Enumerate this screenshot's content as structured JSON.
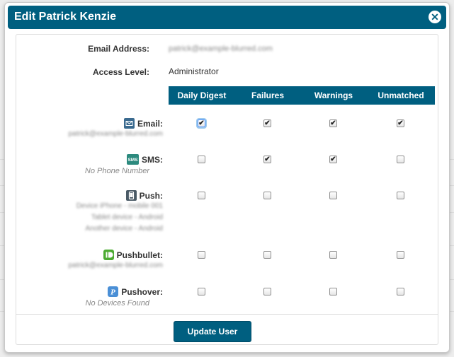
{
  "dialog": {
    "title": "Edit Patrick Kenzie",
    "close_glyph": "✕"
  },
  "account": {
    "email_label": "Email Address:",
    "email_value": "patrick@example-blurred.com",
    "access_label": "Access Level:",
    "access_value": "Administrator"
  },
  "columns": [
    "Daily Digest",
    "Failures",
    "Warnings",
    "Unmatched"
  ],
  "rows": [
    {
      "label": "Email:",
      "icon": "envelope-icon",
      "icon_color": "#3a6a8f",
      "icon_glyph": "✉",
      "sub": [
        "patrick@example-blurred.com"
      ],
      "sub_blurred": true,
      "checks": [
        true,
        true,
        true,
        true
      ]
    },
    {
      "label": "SMS:",
      "icon": "sms-icon",
      "icon_color": "#2c8a7e",
      "icon_glyph": "SMS",
      "sub": [
        "No Phone Number"
      ],
      "sub_blurred": false,
      "checks": [
        false,
        true,
        true,
        false
      ]
    },
    {
      "label": "Push:",
      "icon": "phone-icon",
      "icon_color": "#4a5a66",
      "icon_glyph": "▯",
      "sub": [
        "Device iPhone - mobile 001",
        "Tablet device - Android",
        "Another device - Android"
      ],
      "sub_blurred": true,
      "checks": [
        false,
        false,
        false,
        false
      ]
    },
    {
      "label": "Pushbullet:",
      "icon": "pushbullet-icon",
      "icon_color": "#4cab32",
      "icon_glyph": "▮",
      "sub": [
        "patrick@example-blurred.com"
      ],
      "sub_blurred": true,
      "checks": [
        false,
        false,
        false,
        false
      ]
    },
    {
      "label": "Pushover:",
      "icon": "pushover-icon",
      "icon_color": "#4a8fd6",
      "icon_glyph": "P",
      "sub": [
        "No Devices Found"
      ],
      "sub_blurred": false,
      "checks": [
        false,
        false,
        false,
        false
      ]
    }
  ],
  "focused_checkbox": {
    "row": 0,
    "col": 0
  },
  "actions": {
    "update_label": "Update User"
  },
  "colors": {
    "brand": "#005f80"
  }
}
